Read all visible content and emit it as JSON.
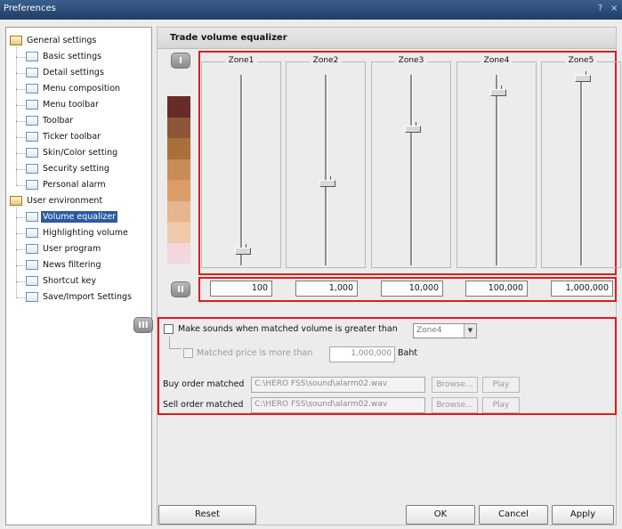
{
  "window": {
    "title": "Preferences",
    "help_label": "?",
    "close_label": "×"
  },
  "tree": {
    "items": [
      {
        "label": "General settings",
        "kind": "category"
      },
      {
        "label": "Basic settings",
        "kind": "leaf"
      },
      {
        "label": "Detail settings",
        "kind": "leaf"
      },
      {
        "label": "Menu composition",
        "kind": "leaf"
      },
      {
        "label": "Menu toolbar",
        "kind": "leaf"
      },
      {
        "label": "Toolbar",
        "kind": "leaf"
      },
      {
        "label": "Ticker toolbar",
        "kind": "leaf"
      },
      {
        "label": "Skin/Color setting",
        "kind": "leaf"
      },
      {
        "label": "Security setting",
        "kind": "leaf"
      },
      {
        "label": "Personal alarm",
        "kind": "leaf"
      },
      {
        "label": "User environment",
        "kind": "category"
      },
      {
        "label": "Volume equalizer",
        "kind": "leaf",
        "selected": true
      },
      {
        "label": "Highlighting volume",
        "kind": "leaf"
      },
      {
        "label": "User program",
        "kind": "leaf"
      },
      {
        "label": "News filtering",
        "kind": "leaf"
      },
      {
        "label": "Shortcut key",
        "kind": "leaf"
      },
      {
        "label": "Save/Import Settings",
        "kind": "leaf"
      }
    ]
  },
  "panel": {
    "title": "Trade volume equalizer",
    "badges": {
      "one": "I",
      "two": "II",
      "three": "III"
    },
    "zones": [
      {
        "label": "Zone1",
        "value": "100",
        "level": 0.05
      },
      {
        "label": "Zone2",
        "value": "1,000",
        "level": 0.42
      },
      {
        "label": "Zone3",
        "value": "10,000",
        "level": 0.72
      },
      {
        "label": "Zone4",
        "value": "100,000",
        "level": 0.92
      },
      {
        "label": "Zone5",
        "value": "1,000,000",
        "level": 1.0
      }
    ],
    "color_scale": [
      "#6b2a2a",
      "#8d5637",
      "#a9703c",
      "#c98c57",
      "#dc9d6a",
      "#e6b48d",
      "#f0c9ab",
      "#f3d7dd"
    ],
    "sound": {
      "make_sounds_label": "Make sounds when matched volume is greater than",
      "zone_select_value": "Zone4",
      "matched_price_label": "Matched price is more than",
      "matched_price_value": "1,000,000",
      "matched_price_unit": "Baht",
      "buy_label": "Buy order matched",
      "buy_path": "C:\\HERO FSS\\sound\\alarm02.wav",
      "sell_label": "Sell order matched",
      "sell_path": "C:\\HERO FSS\\sound\\alarm02.wav",
      "browse_label": "Browse...",
      "play_label": "Play"
    }
  },
  "buttons": {
    "reset": "Reset",
    "ok": "OK",
    "cancel": "Cancel",
    "apply": "Apply"
  },
  "colors": {
    "highlight": "#e01b1b",
    "selection": "#2d5aa0"
  }
}
